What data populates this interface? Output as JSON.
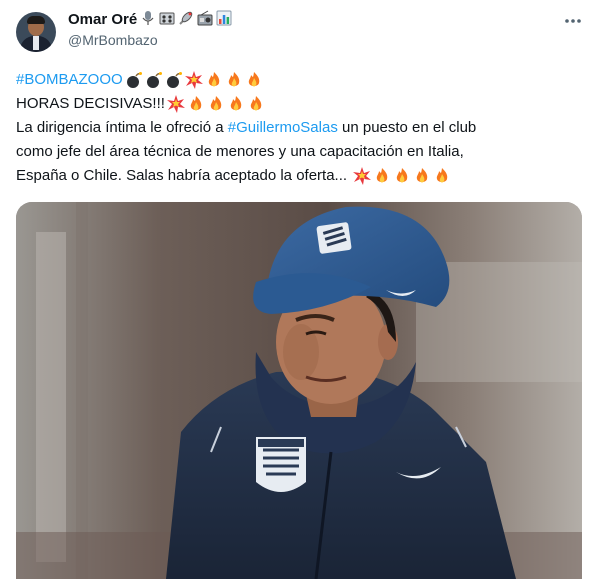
{
  "author": {
    "name": "Omar Oré",
    "handle": "@MrBombazo",
    "name_icons": [
      "microphone-icon",
      "radio-icon",
      "satellite-icon",
      "radio-device-icon",
      "bar-chart-icon"
    ]
  },
  "more_icon": "more-horizontal-icon",
  "tweet": {
    "line1_hashtag": "#BOMBAZOOO",
    "line1_emojis": [
      "bomb-emoji",
      "bomb-emoji",
      "bomb-emoji",
      "collision-emoji",
      "fire-emoji",
      "fire-emoji",
      "fire-emoji"
    ],
    "line2_text": "HORAS DECISIVAS!!!",
    "line2_emojis": [
      "collision-emoji",
      "fire-emoji",
      "fire-emoji",
      "fire-emoji",
      "fire-emoji"
    ],
    "line3_pre": "La dirigencia íntima le ofreció a ",
    "line3_hashtag": "#GuillermoSalas",
    "line3_post": " un puesto en el club",
    "line4_text": "como jefe del área técnica de menores y una capacitación en Italia,",
    "line5_text": "España o Chile. Salas habría aceptado la oferta... ",
    "line5_emojis": [
      "collision-emoji",
      "fire-emoji",
      "fire-emoji",
      "fire-emoji",
      "fire-emoji"
    ]
  },
  "media": {
    "subject": "photo-coach-in-blue-cap-and-jacket"
  },
  "colors": {
    "link": "#1d9bf0",
    "text": "#0f1419",
    "secondary": "#536471",
    "jacket": "#24324a",
    "cap": "#2d5688"
  }
}
